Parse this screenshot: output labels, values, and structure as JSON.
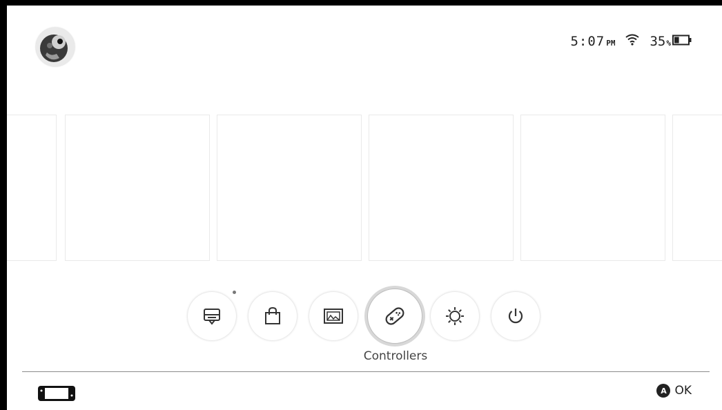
{
  "status": {
    "time": "5:07",
    "ampm": "PM",
    "battery_level": "35",
    "battery_unit": "%",
    "battery_fill_fraction": 0.35
  },
  "tiles": [
    {
      "name": "game-tile-1"
    },
    {
      "name": "game-tile-2"
    },
    {
      "name": "game-tile-3"
    },
    {
      "name": "game-tile-4"
    },
    {
      "name": "game-tile-5"
    },
    {
      "name": "game-tile-6"
    }
  ],
  "dock": {
    "items": [
      {
        "icon": "news-icon"
      },
      {
        "icon": "shop-icon"
      },
      {
        "icon": "album-icon"
      },
      {
        "icon": "controller-icon",
        "selected": true
      },
      {
        "icon": "settings-icon"
      },
      {
        "icon": "power-icon"
      }
    ],
    "selected_label": "Controllers"
  },
  "footer": {
    "button_glyph": "A",
    "action_label": "OK"
  }
}
